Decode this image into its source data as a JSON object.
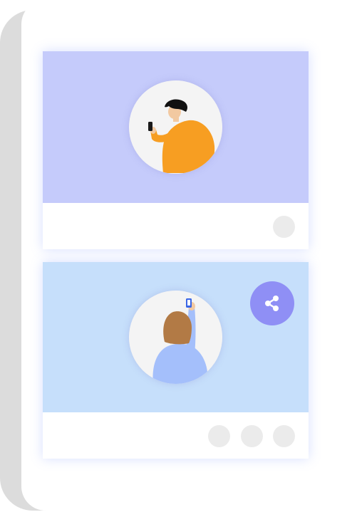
{
  "colors": {
    "card1_banner": "#c5cbfb",
    "card2_banner": "#c6dffb",
    "share_button": "#8f8ff5",
    "footer_dot": "#ebebeb",
    "phone_frame_shadow": "#dcdcdc"
  },
  "cards": [
    {
      "illustration": "person-looking-at-phone-illustration",
      "footer_buttons": 1
    },
    {
      "illustration": "person-holding-up-phone-illustration",
      "overlay_icon": "share-icon",
      "footer_buttons": 3
    }
  ]
}
